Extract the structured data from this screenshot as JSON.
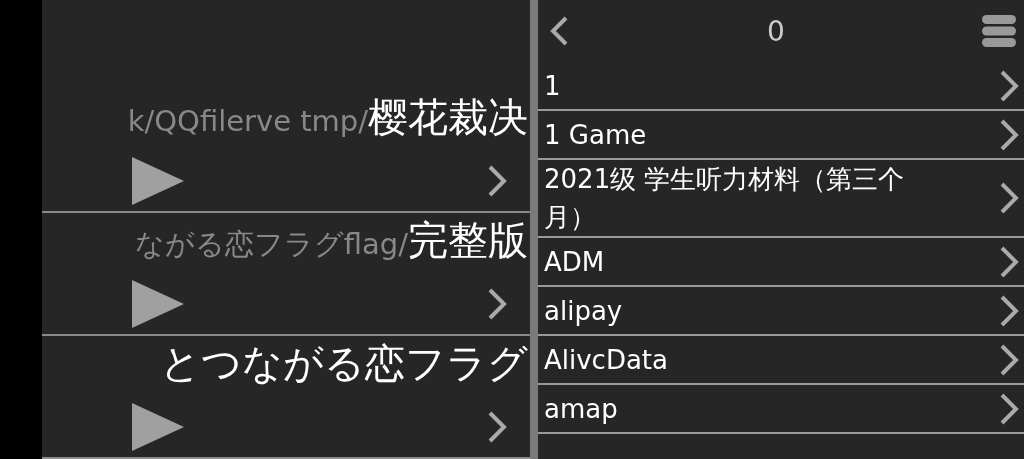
{
  "player_list": [
    {
      "path": "k/QQfilerve tmp/",
      "title": "樱花裁决"
    },
    {
      "path": "ながる恋フラグflag/",
      "title": "完整版"
    },
    {
      "title": "とつながる恋フラグ"
    }
  ],
  "browser": {
    "current": "0",
    "entries": [
      {
        "name": "1"
      },
      {
        "name": "1 Game"
      },
      {
        "name": "2021级 学生听力材料（第三个月）"
      },
      {
        "name": "ADM"
      },
      {
        "name": "alipay"
      },
      {
        "name": "AlivcData"
      },
      {
        "name": "amap"
      }
    ]
  }
}
